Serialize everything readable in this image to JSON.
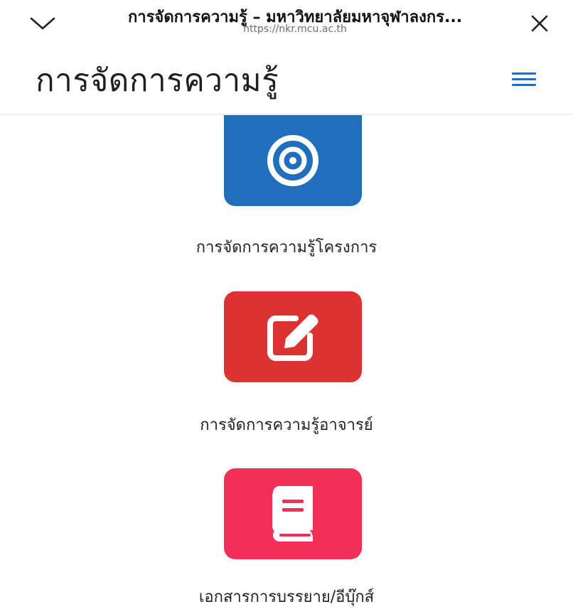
{
  "browser": {
    "title": "การจัดการความรู้ – มหาวิทยาลัยมหาจุฬาลงกร...",
    "url": "https://nkr.mcu.ac.th",
    "collapse_icon": "chevron-down-icon",
    "close_icon": "close-icon"
  },
  "header": {
    "site_title": "การจัดการความรู้",
    "menu_icon": "hamburger-menu-icon",
    "accent_color": "#1f6fbd"
  },
  "tiles": [
    {
      "label": "การจัดการความรู้โครงการ",
      "icon": "target-icon",
      "color": "#1f6fbd"
    },
    {
      "label": "การจัดการความรู้อาจารย์",
      "icon": "edit-icon",
      "color": "#dc3232"
    },
    {
      "label": "เอกสารการบรรยาย/อีบุ๊กส์",
      "icon": "book-icon",
      "color": "#f23057"
    }
  ]
}
